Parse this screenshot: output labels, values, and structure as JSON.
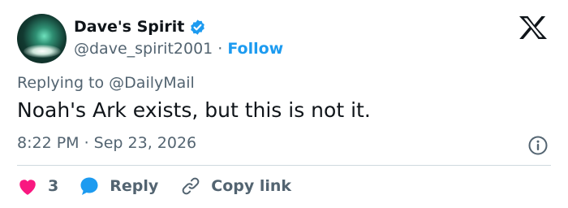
{
  "author": {
    "display_name": "Dave's Spirit",
    "handle": "@dave_spirit2001",
    "separator": "·",
    "follow_label": "Follow"
  },
  "reply_context": {
    "prefix": "Replying to",
    "mention": "@DailyMail"
  },
  "tweet": {
    "text": "Noah's Ark exists, but this is not it.",
    "timestamp": "8:22 PM · Sep 23, 2026"
  },
  "actions": {
    "like_count": "3",
    "reply_label": "Reply",
    "copy_label": "Copy link"
  },
  "colors": {
    "accent": "#1d9bf0",
    "like": "#f91880",
    "muted": "#536471",
    "text": "#0f1419"
  },
  "icons": [
    "verified-badge-icon",
    "x-logo-icon",
    "info-icon",
    "heart-icon",
    "reply-bubble-icon",
    "link-icon"
  ]
}
